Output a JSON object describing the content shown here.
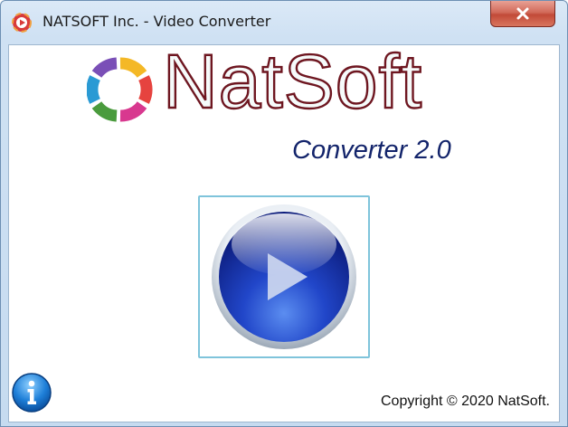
{
  "window": {
    "title": "NATSOFT Inc. - Video Converter",
    "close_glyph": "×"
  },
  "header": {
    "brand": "NatSoft",
    "product": "Converter 2.0"
  },
  "footer": {
    "copyright": "Copyright © 2020 NatSoft."
  },
  "icons": {
    "app": "app-icon",
    "logo": "aperture-logo-icon",
    "play": "play-icon",
    "info": "info-icon",
    "close": "close-icon"
  },
  "colors": {
    "brand_outline": "#6e1620",
    "product_text": "#13246b",
    "play_frame_border": "#7fc4db",
    "close_button": "#c24a38",
    "info_button": "#1e7fd8"
  }
}
